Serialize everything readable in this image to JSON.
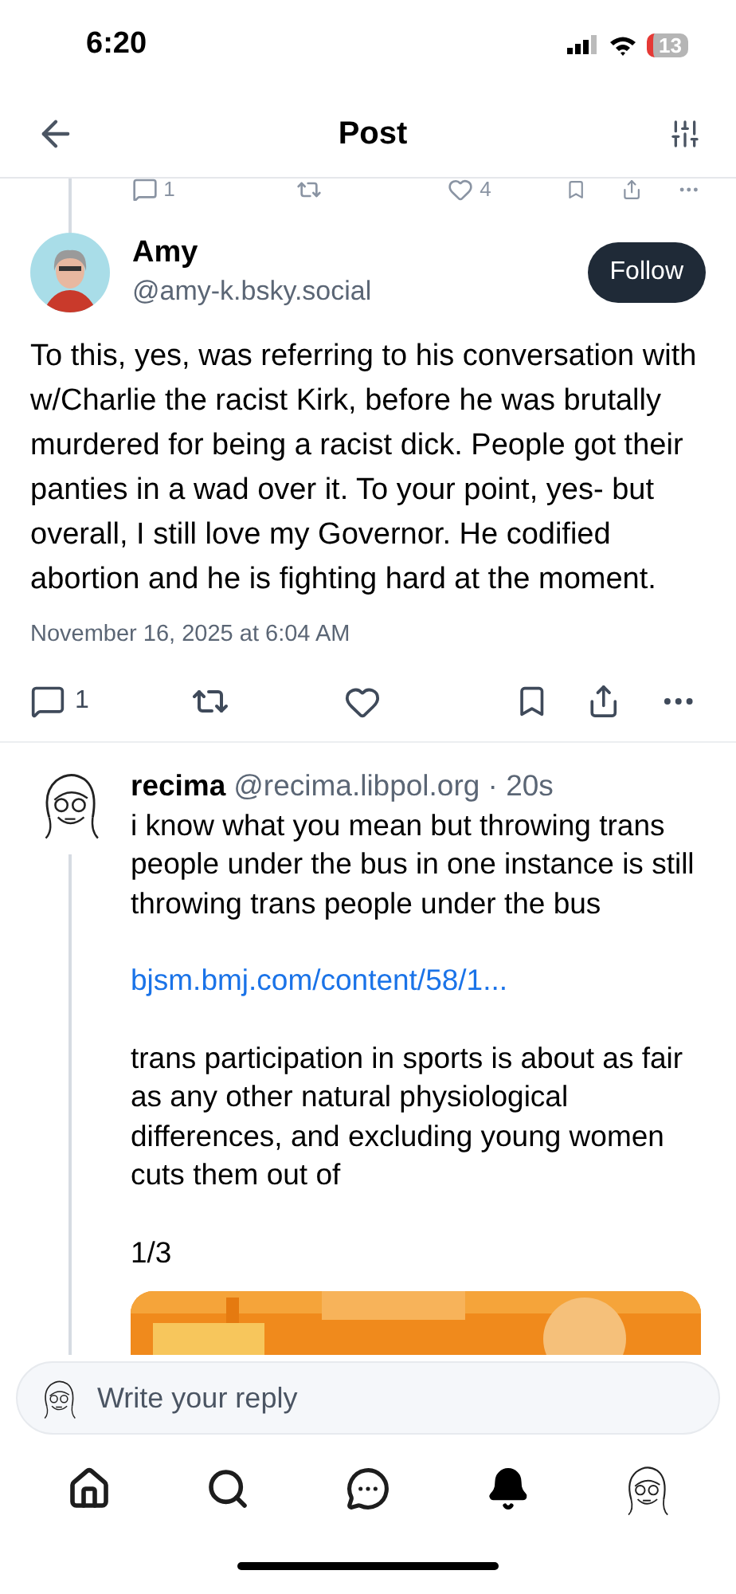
{
  "status_bar": {
    "time": "6:20",
    "battery": "13"
  },
  "header": {
    "title": "Post"
  },
  "previous_post_actions": {
    "replies": "1",
    "likes": "4"
  },
  "post": {
    "name": "Amy",
    "handle": "@amy-k.bsky.social",
    "follow_label": "Follow",
    "text": "To this, yes, was referring to his conversation with w/Charlie the racist Kirk, before he was brutally murdered for being a racist dick. People got their panties in a wad over it.  To your point, yes- but overall, I still love my Governor.  He codified abortion and he is fighting hard at the moment.",
    "timestamp": "November 16, 2025 at 6:04 AM",
    "replies": "1"
  },
  "reply": {
    "name": "recima",
    "handle": "@recima.libpol.org · 20s",
    "paragraphs": [
      {
        "kind": "text",
        "text": "i know what you mean but throwing trans people under the bus in one instance is still throwing trans people under the bus"
      },
      {
        "kind": "link",
        "text": "bjsm.bmj.com/content/58/1..."
      },
      {
        "kind": "text",
        "text": "trans participation in sports is about as fair as any other natural physiological differences, and excluding young women cuts them out of"
      },
      {
        "kind": "text",
        "text": "1/3"
      }
    ]
  },
  "composer": {
    "placeholder": "Write your reply"
  },
  "tab_bar": [
    {
      "kind": "home",
      "selected": false
    },
    {
      "kind": "search",
      "selected": false
    },
    {
      "kind": "chat",
      "selected": false
    },
    {
      "kind": "bell",
      "selected": true
    },
    {
      "kind": "profile",
      "selected": false
    }
  ]
}
